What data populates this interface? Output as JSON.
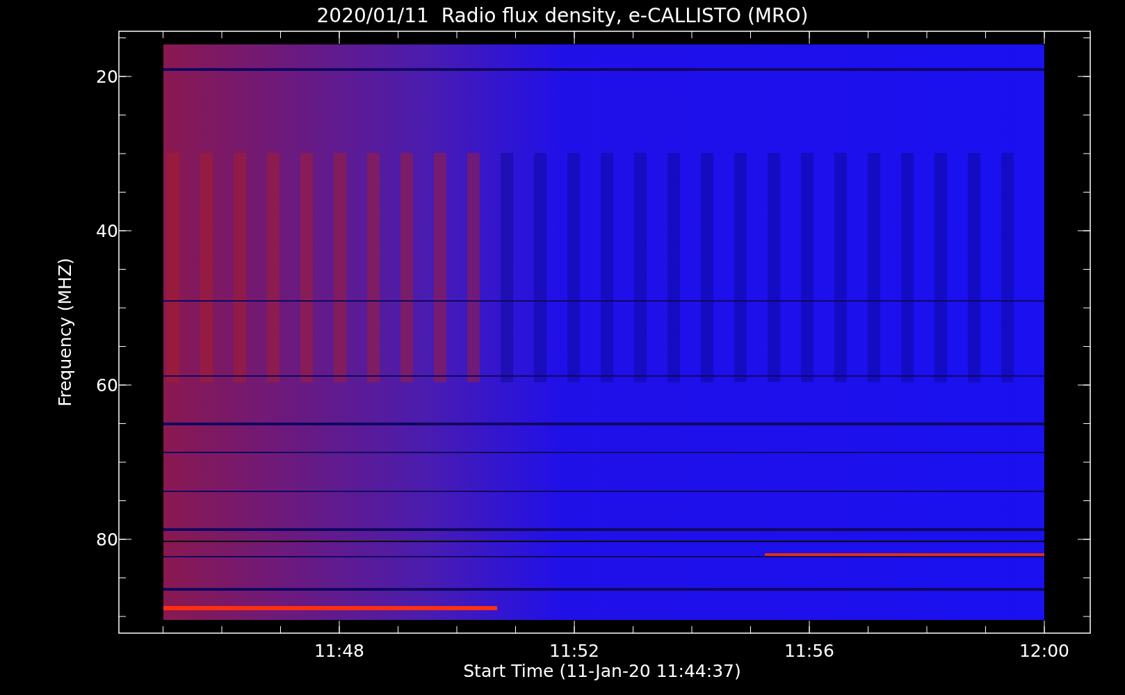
{
  "title": "2020/01/11  Radio flux density, e-CALLISTO (MRO)",
  "y_axis": {
    "label": "Frequency (MHZ)",
    "ticks": [
      "20",
      "40",
      "60",
      "80"
    ]
  },
  "x_axis": {
    "label": "Start Time (11-Jan-20 11:44:37)",
    "ticks": [
      "11:48",
      "11:52",
      "11:56",
      "12:00"
    ]
  }
}
